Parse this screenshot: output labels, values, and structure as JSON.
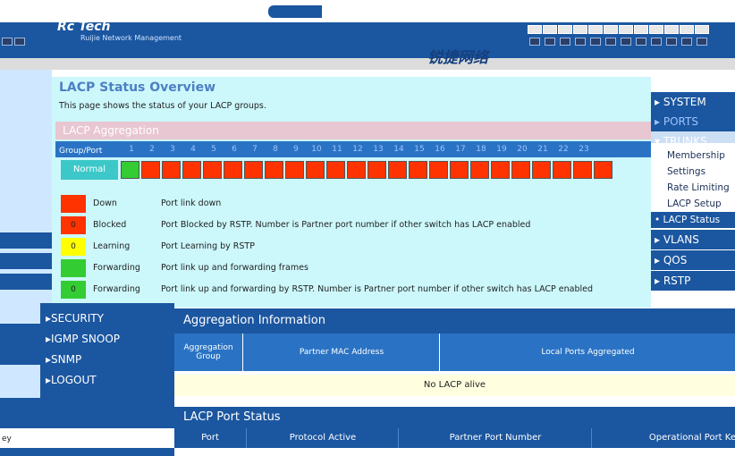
{
  "header": {
    "title": "Rc Tech",
    "subtitle": "Ruijie Network Management",
    "brand": "锐捷网络"
  },
  "page": {
    "title": "LACP Status Overview",
    "description": "This page shows the status of your LACP groups."
  },
  "lacp_aggregation": {
    "heading": "LACP Aggregation",
    "group_port_label": "Group/Port",
    "ports": [
      "1",
      "2",
      "3",
      "4",
      "5",
      "6",
      "7",
      "8",
      "9",
      "10",
      "11",
      "12",
      "13",
      "14",
      "15",
      "16",
      "17",
      "18",
      "19",
      "20",
      "21",
      "22",
      "23"
    ],
    "group_name": "Normal",
    "port_states": [
      "forwarding",
      "down",
      "down",
      "down",
      "down",
      "down",
      "down",
      "down",
      "down",
      "down",
      "down",
      "down",
      "down",
      "down",
      "down",
      "down",
      "down",
      "down",
      "down",
      "down",
      "down",
      "down",
      "down",
      "down"
    ]
  },
  "legend": [
    {
      "color": "#ff3300",
      "code": "",
      "name": "Down",
      "desc": "Port link down"
    },
    {
      "color": "#ff3300",
      "code": "0",
      "name": "Blocked",
      "desc": "Port Blocked by RSTP. Number is Partner port number if other switch has LACP enabled"
    },
    {
      "color": "#ffff00",
      "code": "0",
      "name": "Learning",
      "desc": "Port Learning by RSTP"
    },
    {
      "color": "#33cc33",
      "code": "",
      "name": "Forwarding",
      "desc": "Port link up and forwarding frames"
    },
    {
      "color": "#33cc33",
      "code": "0",
      "name": "Forwarding",
      "desc": "Port link up and forwarding by RSTP. Number is Partner port number if other switch has LACP enabled"
    }
  ],
  "right_nav": {
    "system": "SYSTEM",
    "ports": "PORTS",
    "trunks": "TRUNKS",
    "trunks_sub": [
      "Membership",
      "Settings",
      "Rate Limiting",
      "LACP Setup",
      "LACP Status"
    ],
    "vlans": "VLANS",
    "qos": "QOS",
    "rstp": "RSTP"
  },
  "left_menu": {
    "items": [
      "SECURITY",
      "IGMP SNOOP",
      "SNMP",
      "LOGOUT"
    ]
  },
  "aggregation_info": {
    "heading": "Aggregation Information",
    "columns": [
      "Aggregation Group",
      "Partner MAC Address",
      "Local Ports Aggregated"
    ],
    "empty_text": "No LACP alive"
  },
  "port_status": {
    "heading": "LACP Port Status",
    "columns": [
      "Port",
      "Protocol Active",
      "Partner Port Number",
      "Operational Port Ke"
    ],
    "left_cut_label": "ey"
  },
  "colors": {
    "down": "#ff3300",
    "forwarding": "#33cc33",
    "blue": "#1b56a0"
  }
}
